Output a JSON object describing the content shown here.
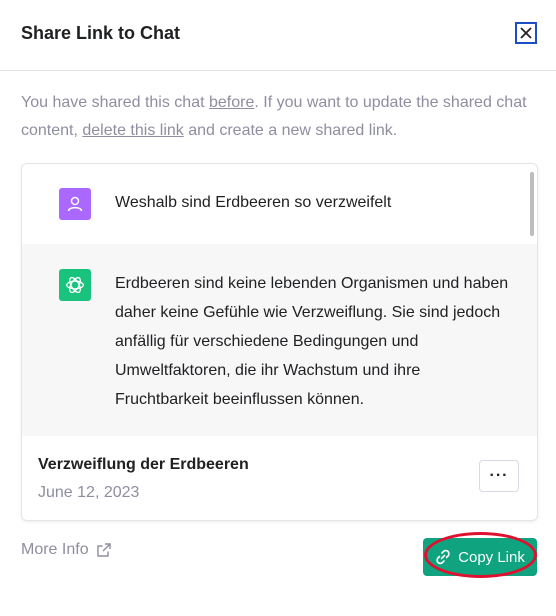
{
  "dialog": {
    "title": "Share Link to Chat",
    "close_icon": "close-icon"
  },
  "intro": {
    "part1": "You have shared this chat ",
    "link1": "before",
    "part2": ". If you want to update the shared chat content, ",
    "link2": "delete this link",
    "part3": " and create a new shared link."
  },
  "conversation": {
    "user_icon": "user-icon",
    "user_message": "Weshalb sind Erdbeeren so verzweifelt",
    "bot_icon": "chatgpt-logo-icon",
    "bot_message": "Erdbeeren sind keine lebenden Organismen und haben daher keine Gefühle wie Verzweiflung. Sie sind jedoch anfällig für verschiedene Bedingungen und Umweltfaktoren, die ihr Wachstum und ihre Fruchtbarkeit beeinflussen können."
  },
  "chat_meta": {
    "title": "Verzweiflung der Erdbeeren",
    "date": "June 12, 2023",
    "more_label": "···"
  },
  "footer": {
    "more_info_label": "More Info",
    "external_icon": "external-link-icon",
    "copy_link_label": "Copy Link",
    "copy_icon": "link-icon"
  },
  "colors": {
    "accent_green": "#10a37f",
    "user_avatar": "#ab68ff",
    "bot_avatar": "#19c37d",
    "annotation_red": "#e0102f"
  }
}
